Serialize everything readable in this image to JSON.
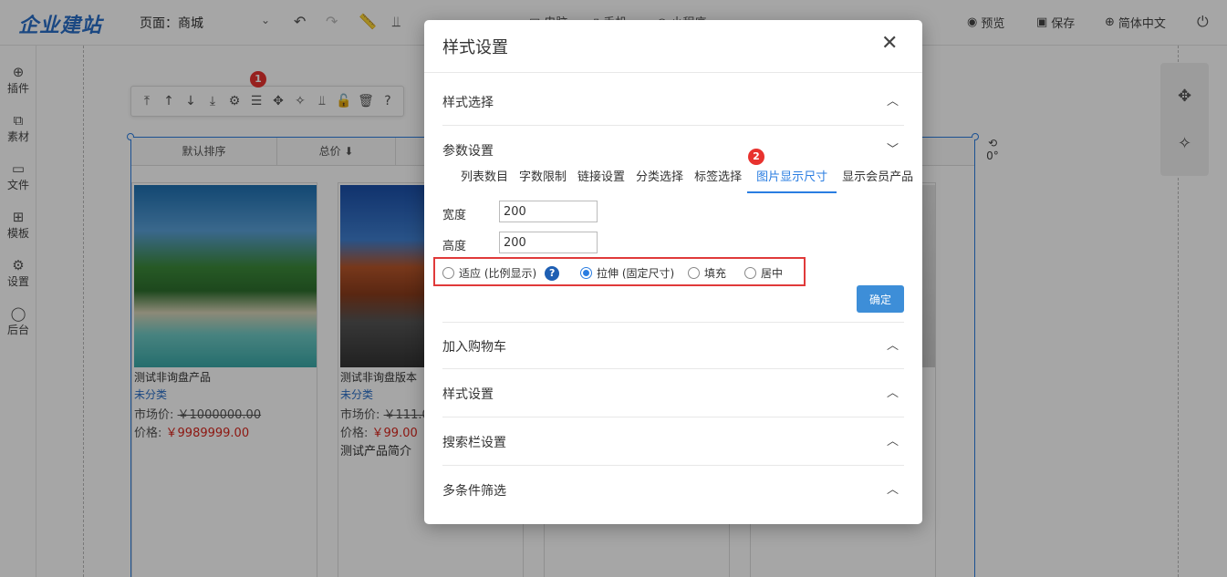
{
  "app": {
    "logo": "企业建站",
    "page_label": "页面：",
    "page_value": "商城"
  },
  "topbar": {
    "mid_items": [
      "电脑",
      "手机",
      "小程序"
    ],
    "right": {
      "preview": "预览",
      "save": "保存",
      "language": "简体中文"
    }
  },
  "sidebar": {
    "items": [
      {
        "label": "插件",
        "icon": "plus-circle-icon"
      },
      {
        "label": "素材",
        "icon": "shapes-icon"
      },
      {
        "label": "文件",
        "icon": "monitor-icon"
      },
      {
        "label": "模板",
        "icon": "grid-icon"
      },
      {
        "label": "设置",
        "icon": "gear-icon"
      },
      {
        "label": "后台",
        "icon": "user-icon"
      }
    ]
  },
  "canvas": {
    "toolbar_badge": "1",
    "sort": {
      "default": "默认排序",
      "total": "总价 ⬇"
    },
    "rotation": "0°",
    "products": [
      {
        "name": "测试非询盘产品",
        "category": "未分类",
        "market_label": "市场价:",
        "market_price": "￥1000000.00",
        "price_label": "价格:",
        "price": "￥9989999.00",
        "desc": ""
      },
      {
        "name": "测试非询盘版本",
        "category": "未分类",
        "market_label": "市场价:",
        "market_price": "￥111.00",
        "price_label": "价格:",
        "price": "￥99.00",
        "desc": "测试产品简介"
      }
    ]
  },
  "modal": {
    "title": "样式设置",
    "sections_top": [
      {
        "label": "样式选择",
        "expanded": false
      }
    ],
    "params": {
      "label": "参数设置",
      "badge": "2",
      "tabs": [
        "列表数目",
        "字数限制",
        "链接设置",
        "分类选择",
        "标签选择",
        "图片显示尺寸",
        "显示会员产品"
      ],
      "active_tab": "图片显示尺寸",
      "width_label": "宽度",
      "width_value": "200",
      "height_label": "高度",
      "height_value": "200",
      "radio_options": [
        {
          "label": "适应 (比例显示)",
          "checked": false
        },
        {
          "label": "拉伸 (固定尺寸)",
          "checked": true
        },
        {
          "label": "填充",
          "checked": false
        },
        {
          "label": "居中",
          "checked": false
        }
      ],
      "help": "?",
      "confirm": "确定"
    },
    "sections_bottom": [
      {
        "label": "加入购物车"
      },
      {
        "label": "样式设置"
      },
      {
        "label": "搜索栏设置"
      },
      {
        "label": "多条件筛选"
      }
    ]
  },
  "colors": {
    "brand": "#2a6fc8",
    "accent": "#2a7de1",
    "danger": "#e03a3a",
    "price": "#d9251c"
  }
}
